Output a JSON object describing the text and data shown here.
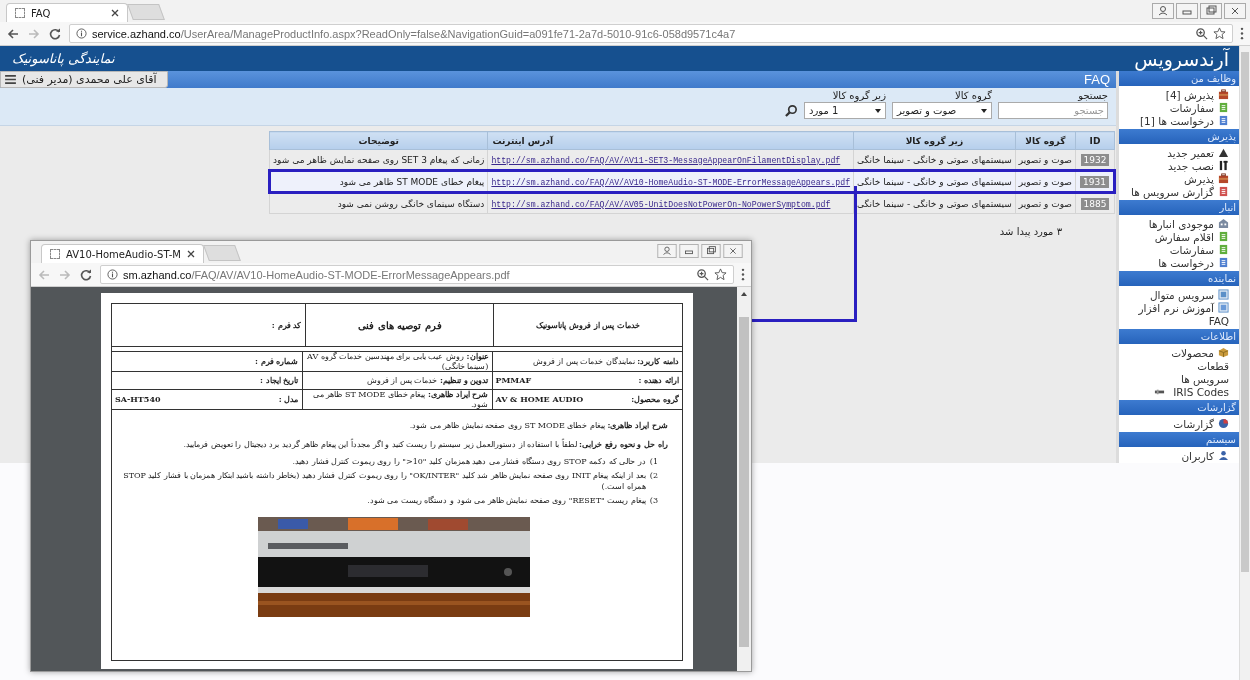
{
  "browser": {
    "tab": {
      "title": "FAQ"
    },
    "url_host": "service.azhand.co",
    "url_path": "/UserArea/ManageProductInfo.aspx?ReadOnly=false&NavigationGuid=a091fe71-2a7d-5010-91c6-058d9571c4a7"
  },
  "header": {
    "brand": "نمایندگی پاناسونیک",
    "logo": "آرندسرویس"
  },
  "user_menu": {
    "label": "آقای علی محمدی (مدیر فنی)"
  },
  "page_title": "FAQ",
  "filters": {
    "search_label": "جستجو",
    "search_placeholder": "جستجو",
    "group_label": "گروه کالا",
    "group_value": "صوت و تصویر",
    "subgroup_label": "زیر گروه کالا",
    "subgroup_value": "1 مورد"
  },
  "table": {
    "columns": [
      "ID",
      "گروه کالا",
      "زیر گروه کالا",
      "آدرس اینترنت",
      "توضیحات"
    ],
    "rows": [
      {
        "id": "1932",
        "group": "صوت و تصویر",
        "subgroup": "سیستمهای صوتی و خانگی - سینما خانگی",
        "url": "http://sm.azhand.co/FAQ/AV/AV11-SET3-MessageAppearOnFilamentDisplay.pdf",
        "description": "زمانی که پیغام SET 3 روی صفحه نمایش ظاهر می شود",
        "selected": false
      },
      {
        "id": "1931",
        "group": "صوت و تصویر",
        "subgroup": "سیستمهای صوتی و خانگی - سینما خانگی",
        "url": "http://sm.azhand.co/FAQ/AV/AV10-HomeAudio-ST-MODE-ErrorMessageAppears.pdf",
        "description": "پیغام خطای ST MODE ظاهر می شود",
        "selected": true
      },
      {
        "id": "1885",
        "group": "صوت و تصویر",
        "subgroup": "سیستمهای صوتی و خانگی - سینما خانگی",
        "url": "http://sm.azhand.co/FAQ/AV/AV05-UnitDoesNotPowerOn-NoPowerSymptom.pdf",
        "description": "دستگاه سینمای خانگی روشن نمی شود",
        "selected": false
      }
    ]
  },
  "result_count": "۳ مورد پیدا شد",
  "sidebar": [
    {
      "title": "وظایف من",
      "items": [
        {
          "label": "پذیرش [4]",
          "kind": "briefcase"
        },
        {
          "label": "سفارشات",
          "kind": "green-doc"
        },
        {
          "label": "درخواست ها [1]",
          "kind": "blue-doc"
        }
      ]
    },
    {
      "title": "پذیرش",
      "items": [
        {
          "label": "تعمیر جدید",
          "kind": "hill"
        },
        {
          "label": "نصب جدید",
          "kind": "tools"
        },
        {
          "label": "پذیرش",
          "kind": "briefcase"
        },
        {
          "label": "گزارش سرویس ها",
          "kind": "red-doc"
        }
      ]
    },
    {
      "title": "انبار",
      "items": [
        {
          "label": "موجودی انبارها",
          "kind": "building"
        },
        {
          "label": "اقلام سفارش",
          "kind": "green-doc"
        },
        {
          "label": "سفارشات",
          "kind": "green-doc"
        },
        {
          "label": "درخواست ها",
          "kind": "blue-doc"
        }
      ]
    },
    {
      "title": "نماینده",
      "items": [
        {
          "label": "سرویس متوال",
          "kind": "screen"
        },
        {
          "label": "آموزش نرم افزار",
          "kind": "film"
        },
        {
          "label": "FAQ",
          "kind": "plain"
        }
      ]
    },
    {
      "title": "اطلاعات",
      "items": [
        {
          "label": "محصولات",
          "kind": "box"
        },
        {
          "label": "قطعات",
          "kind": "plain"
        },
        {
          "label": "سرویس ها",
          "kind": "plain"
        },
        {
          "label": "IRIS Codes",
          "kind": "tag"
        }
      ]
    },
    {
      "title": "گزارشات",
      "items": [
        {
          "label": "گزارشات",
          "kind": "pie"
        }
      ]
    },
    {
      "title": "سیستم",
      "items": [
        {
          "label": "کاربران",
          "kind": "user"
        }
      ]
    }
  ],
  "popup": {
    "tab": {
      "title": "AV10-HomeAudio-ST-M"
    },
    "url_host": "sm.azhand.co",
    "url_path": "/FAQ/AV/AV10-HomeAudio-ST-MODE-ErrorMessageAppears.pdf",
    "document": {
      "org": "خدمات پس از فروش پاناسونیک",
      "form_title": "فرم توصیه های فنی",
      "form_code": "کد فرم :",
      "info": [
        [
          {
            "text": "**دامنه کاربرد:**  نمایندگان خدمات پس از فروش"
          },
          {
            "text": "**عنوان:** روش عیب یابی برای مهندسین خدمات گروه AV (سینما خانگی)"
          },
          {
            "text": "**شماره فرم :**"
          }
        ],
        [
          {
            "text": "**ارائه دهنده :**",
            "value": "PMMAF"
          },
          {
            "text": "**تدوین و تنظیم:** خدمات پس از فروش"
          },
          {
            "text": "**تاریخ ایجاد :**"
          }
        ],
        [
          {
            "text": "**گروه محصول:**",
            "value": "AV & HOME AUDIO"
          },
          {
            "text": "**شرح ایراد ظاهری:** پیغام خطای ST MODE ظاهر می شود."
          },
          {
            "text": "**مدل :**",
            "value": "SA-HT540"
          }
        ]
      ],
      "paragraphs": [
        "**شرح ایراد ظاهری:** پیغام خطای  ST MODE روی صفحه نمایش ظاهر می شود.",
        "**راه حل و نحوه رفع خرابی:** لطفاً با استفاده از دستورالعمل زیر سیستم را ریست کنید و اگر مجدداً این پیغام ظاهر گردید برد دیجیتال را تعویض فرمایید."
      ],
      "steps": [
        {
          "number": "1)",
          "text": "در حالی که دکمه STOP روی دستگاه فشار می دهید همزمان کلید \"10<\" را روی ریموت کنترل فشار دهید."
        },
        {
          "number": "2)",
          "text": "بعد از اینکه پیغام INIT روی صفحه نمایش ظاهر شد کلید \"OK/INTER\" را روی ریموت کنترل فشار دهید (بخاطر داشته باشید ابتکار همزمان با فشار کلید STOP همراه است.)"
        },
        {
          "number": "3)",
          "text": "پیغام ریست \"RESET\" روی صفحه نمایش ظاهر می شود و دستگاه ریست می شود."
        }
      ],
      "image": {
        "kind": "picture"
      }
    }
  }
}
